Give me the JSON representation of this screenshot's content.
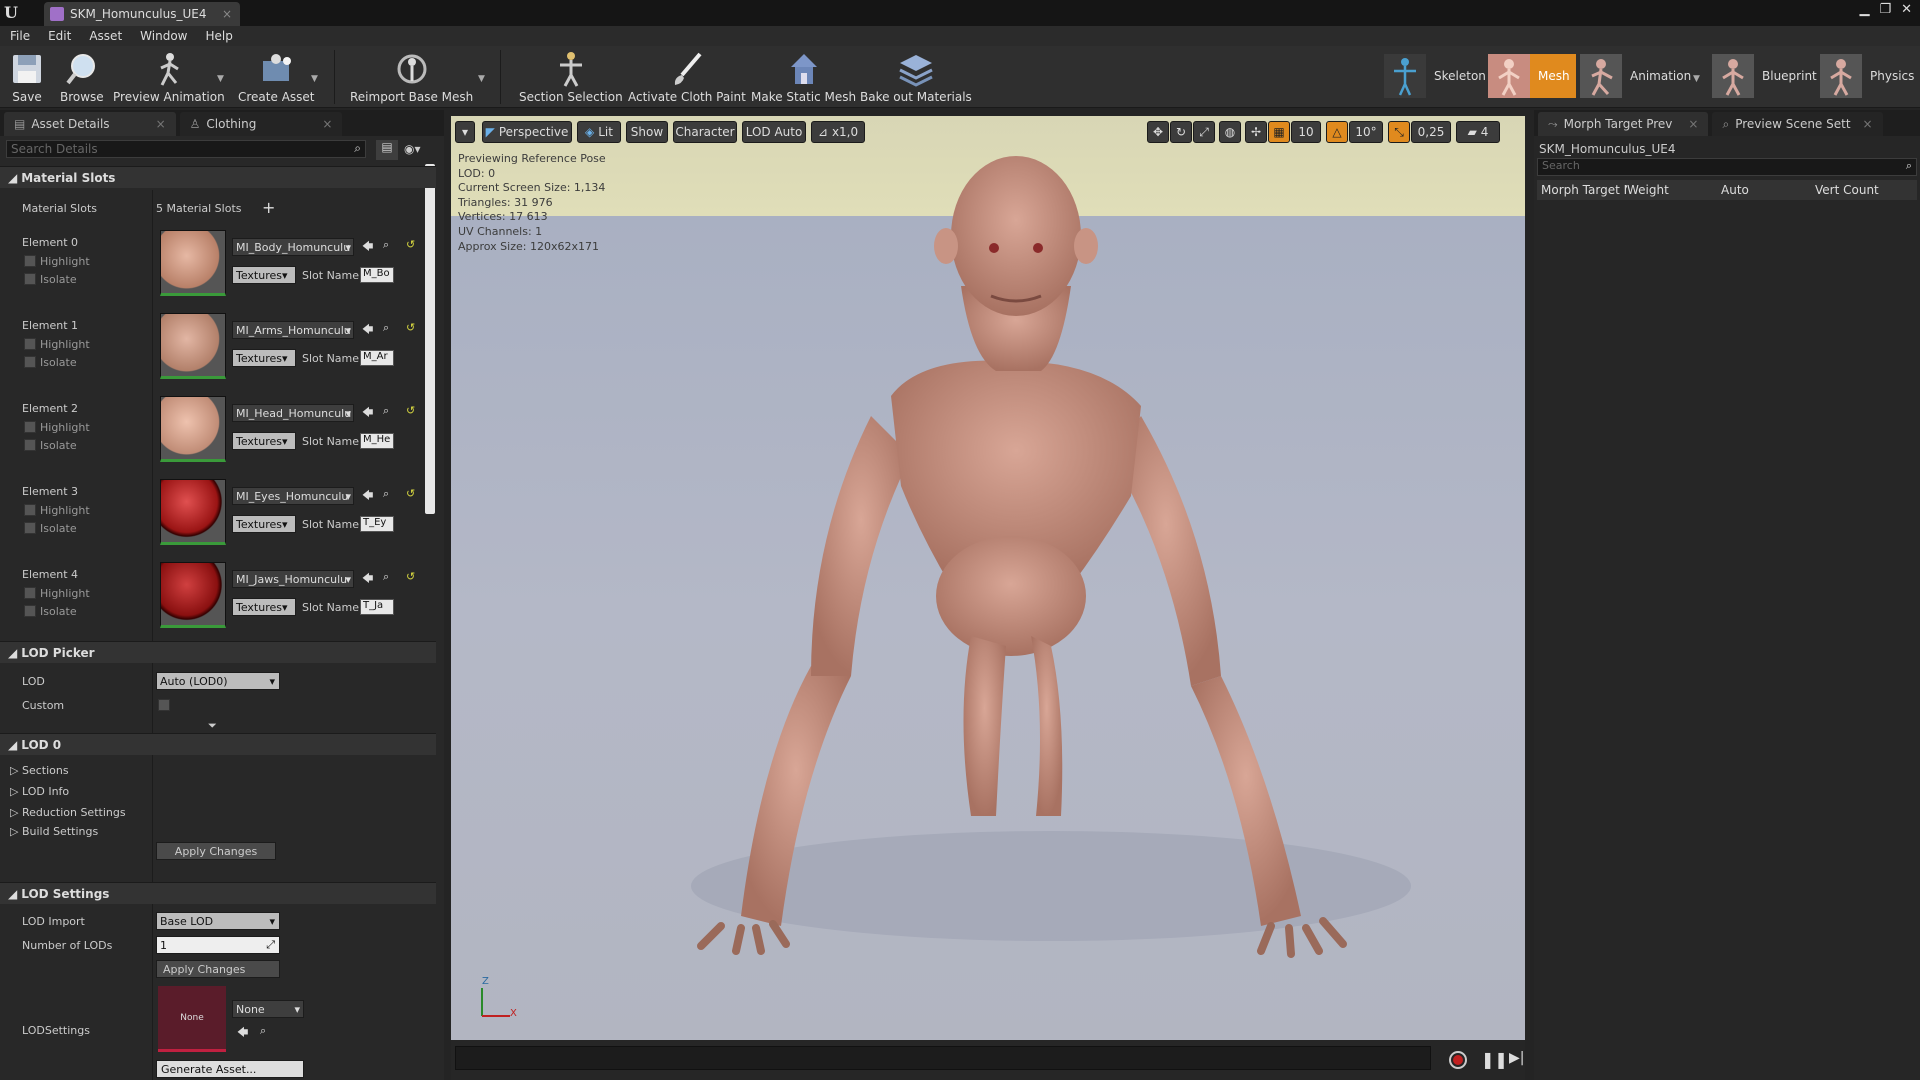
{
  "window": {
    "tab_title": "SKM_Homunculus_UE4"
  },
  "menu": [
    "File",
    "Edit",
    "Asset",
    "Window",
    "Help"
  ],
  "toolbar": {
    "save": "Save",
    "browse": "Browse",
    "preview_animation": "Preview Animation",
    "create_asset": "Create Asset",
    "reimport": "Reimport Base Mesh",
    "section_selection": "Section Selection",
    "activate_cloth": "Activate Cloth Paint",
    "make_static": "Make Static Mesh",
    "bake_materials": "Bake out Materials"
  },
  "modes": {
    "skeleton": "Skeleton",
    "mesh": "Mesh",
    "animation": "Animation",
    "blueprint": "Blueprint",
    "physics": "Physics"
  },
  "left_panel": {
    "tabs": [
      "Asset Details",
      "Clothing"
    ],
    "search_placeholder": "Search Details",
    "material_slots_header": "Material Slots",
    "material_slots_label": "Material Slots",
    "material_slots_count": "5 Material Slots",
    "highlight": "Highlight",
    "isolate": "Isolate",
    "textures": "Textures",
    "slot_name_label": "Slot Name",
    "elements": [
      {
        "label": "Element 0",
        "material": "MI_Body_Homunculu",
        "slot": "M_Bo",
        "color": "#c9967f"
      },
      {
        "label": "Element 1",
        "material": "MI_Arms_Homunculu",
        "slot": "M_Ar",
        "color": "#c59480"
      },
      {
        "label": "Element 2",
        "material": "MI_Head_Homunculu",
        "slot": "M_He",
        "color": "#cf9e88"
      },
      {
        "label": "Element 3",
        "material": "MI_Eyes_Homunculu",
        "slot": "T_Ey",
        "color": "#a01818"
      },
      {
        "label": "Element 4",
        "material": "MI_Jaws_Homunculu",
        "slot": "T_Ja",
        "color": "#8e1212"
      }
    ],
    "lod_picker_header": "LOD Picker",
    "lod_label": "LOD",
    "lod_value": "Auto (LOD0)",
    "custom_label": "Custom",
    "lod0_header": "LOD 0",
    "lod0_items": [
      "Sections",
      "LOD Info",
      "Reduction Settings",
      "Build Settings"
    ],
    "apply_changes": "Apply Changes",
    "lod_settings_header": "LOD Settings",
    "lod_import_label": "LOD Import",
    "lod_import_value": "Base LOD",
    "num_lods_label": "Number of LODs",
    "num_lods_value": "1",
    "lod_settings_label": "LODSettings",
    "lod_settings_thumb": "None",
    "lod_settings_value": "None",
    "generate_asset": "Generate Asset..."
  },
  "viewport": {
    "perspective": "Perspective",
    "lit": "Lit",
    "show": "Show",
    "character": "Character",
    "lod_auto": "LOD Auto",
    "speed": "x1,0",
    "grid_snap": "10",
    "rot_snap": "10°",
    "scale_snap": "0,25",
    "cam_speed": "4",
    "stats": [
      "Previewing Reference Pose",
      "LOD: 0",
      "Current Screen Size: 1,134",
      "Triangles: 31 976",
      "Vertices: 17 613",
      "UV Channels: 1",
      "Approx Size: 120x62x171"
    ],
    "axis_z": "Z",
    "axis_x": "X"
  },
  "right_panel": {
    "tabs": [
      "Morph Target Prev",
      "Preview Scene Sett"
    ],
    "asset_name": "SKM_Homunculus_UE4",
    "search_placeholder": "Search",
    "columns": [
      "Morph Target N",
      "Weight",
      "Auto",
      "Vert Count"
    ]
  },
  "colors": {
    "accent": "#e08a1e",
    "panel": "#282828"
  }
}
